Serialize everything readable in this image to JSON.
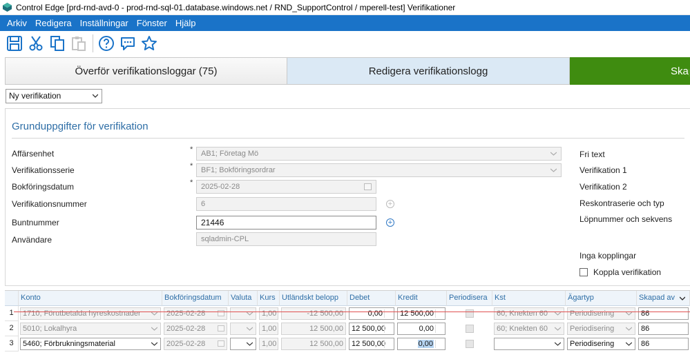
{
  "window": {
    "title": "Control Edge [prd-rnd-avd-0 - prod-rnd-sql-01.database.windows.net / RND_SupportControl / mperell-test] Verifikationer"
  },
  "menu": [
    "Arkiv",
    "Redigera",
    "Inställningar",
    "Fönster",
    "Hjälp"
  ],
  "toolbar": {
    "icons": [
      "save-icon",
      "cut-icon",
      "copy-icon",
      "paste-icon",
      "help-icon",
      "comment-icon",
      "star-icon"
    ]
  },
  "tabs": {
    "transfer": "Överför verifikationsloggar (75)",
    "edit": "Redigera verifikationslogg",
    "create": "Skap"
  },
  "new_select": {
    "value": "Ny verifikation"
  },
  "form": {
    "title": "Grunduppgifter för verifikation",
    "labels": {
      "business_unit": "Affärsenhet",
      "series": "Verifikationsserie",
      "booking_date": "Bokföringsdatum",
      "number": "Verifikationsnummer",
      "batch": "Buntnummer",
      "user": "Användare"
    },
    "values": {
      "business_unit": "AB1; Företag Mö",
      "series": "BF1; Bokföringsordrar",
      "booking_date": "2025-02-28",
      "number": "6",
      "batch": "21446",
      "user": "sqladmin-CPL"
    },
    "right_labels": {
      "free_text": "Fri text",
      "ver1": "Verifikation 1",
      "ver2": "Verifikation 2",
      "ledger": "Reskontraserie och typ",
      "sequence": "Löpnummer och sekvens",
      "no_links": "Inga kopplingar",
      "link_ver": "Koppla verifikation"
    },
    "required_mark": "*"
  },
  "grid": {
    "headers": {
      "konto": "Konto",
      "date": "Bokföringsdatum",
      "valuta": "Valuta",
      "kurs": "Kurs",
      "foreign": "Utländskt belopp",
      "debet": "Debet",
      "kredit": "Kredit",
      "periodisera": "Periodisera",
      "kst": "Kst",
      "agartyp": "Ägartyp",
      "skapad": "Skapad av"
    },
    "rows": [
      {
        "num": "1",
        "konto": "1710; Förutbetalda hyreskostnader",
        "date": "2025-02-28",
        "kurs": "1,00",
        "foreign": "-12 500,00",
        "debet": "0,00",
        "kredit": "12 500,00",
        "kst": "60; Knekten 60",
        "agartyp": "Periodisering",
        "skapad": "86"
      },
      {
        "num": "2",
        "konto": "5010; Lokalhyra",
        "date": "2025-02-28",
        "kurs": "1,00",
        "foreign": "12 500,00",
        "debet": "12 500,00",
        "kredit": "0,00",
        "kst": "60; Knekten 60",
        "agartyp": "Periodisering",
        "skapad": "86"
      },
      {
        "num": "3",
        "konto": "5460; Förbrukningsmaterial",
        "date": "2025-02-28",
        "kurs": "1,00",
        "foreign": "12 500,00",
        "debet": "12 500,00",
        "kredit": "0,00",
        "kst": "",
        "agartyp": "Periodisering",
        "skapad": "86"
      }
    ]
  }
}
